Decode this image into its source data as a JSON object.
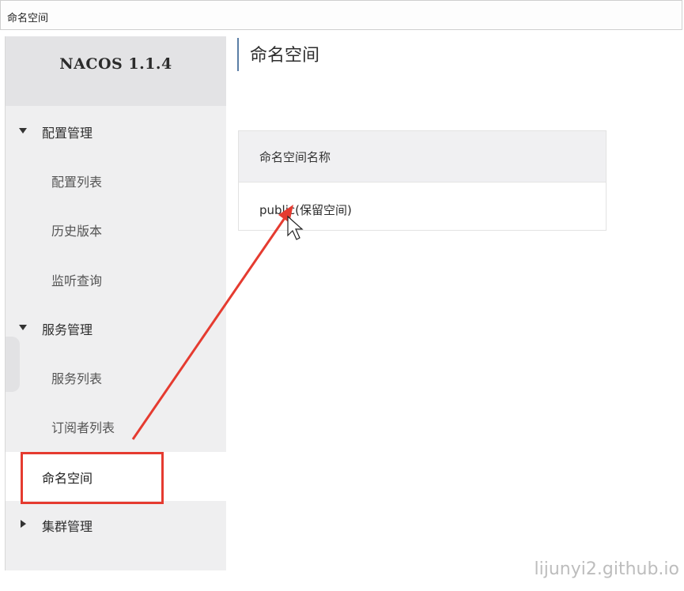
{
  "window": {
    "title": "命名空间"
  },
  "sidebar": {
    "logo": "NACOS 1.1.4",
    "groups": [
      {
        "label": "配置管理",
        "expanded": true,
        "items": [
          {
            "label": "配置列表"
          },
          {
            "label": "历史版本"
          },
          {
            "label": "监听查询"
          }
        ]
      },
      {
        "label": "服务管理",
        "expanded": true,
        "items": [
          {
            "label": "服务列表"
          },
          {
            "label": "订阅者列表"
          }
        ]
      }
    ],
    "active_item": "命名空间",
    "collapsed_group": "集群管理"
  },
  "main": {
    "title": "命名空间",
    "table": {
      "header": "命名空间名称",
      "rows": [
        {
          "name": "public(保留空间)"
        }
      ]
    }
  },
  "annotation": {
    "color": "#e53b30"
  },
  "watermark": "lijunyi2.github.io"
}
